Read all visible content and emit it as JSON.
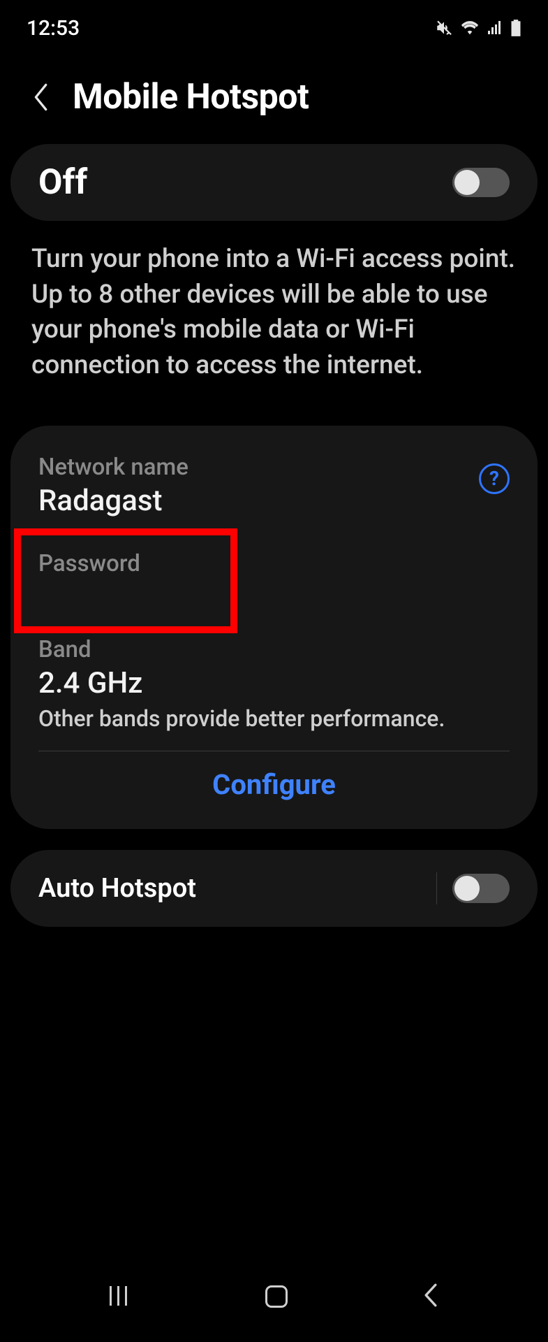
{
  "status": {
    "time": "12:53"
  },
  "header": {
    "title": "Mobile Hotspot"
  },
  "main_toggle": {
    "state_label": "Off",
    "enabled": false
  },
  "description": "Turn your phone into a Wi-Fi access point. Up to 8 other devices will be able to use your phone's mobile data or Wi-Fi connection to access the internet.",
  "network": {
    "name_label": "Network name",
    "name_value": "Radagast",
    "password_label": "Password",
    "password_value": "",
    "band_label": "Band",
    "band_value": "2.4 GHz",
    "band_note": "Other bands provide better performance.",
    "help_glyph": "?"
  },
  "configure_label": "Configure",
  "auto_hotspot": {
    "label": "Auto Hotspot",
    "enabled": false
  },
  "colors": {
    "accent_blue": "#3f82ff",
    "highlight_red": "#ff0000",
    "card_bg": "#171717"
  }
}
